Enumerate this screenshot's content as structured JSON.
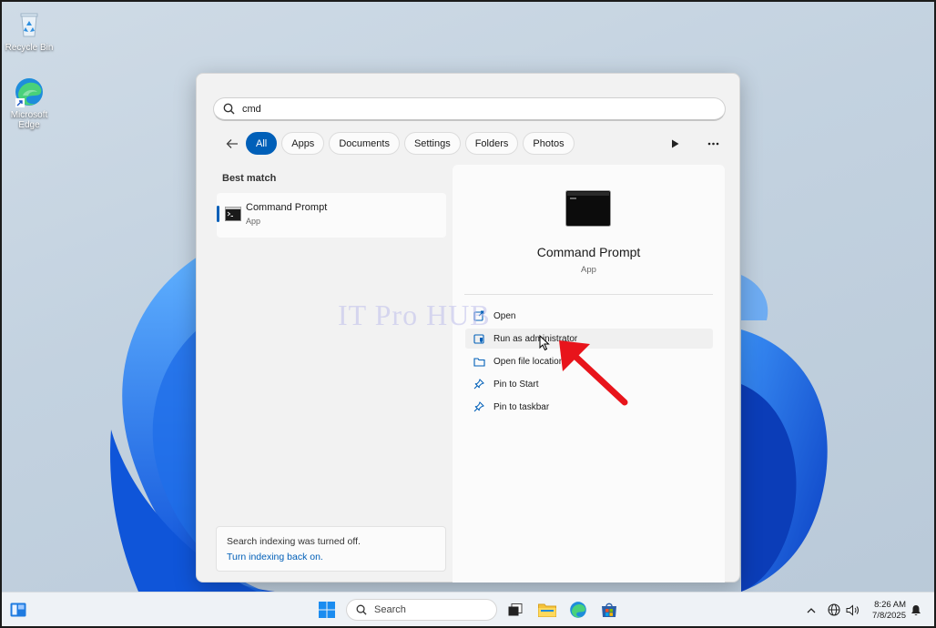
{
  "desktop": {
    "icons": [
      {
        "label": "Recycle Bin"
      },
      {
        "label": "Microsoft Edge"
      }
    ]
  },
  "search": {
    "query": "cmd",
    "filters": [
      "All",
      "Apps",
      "Documents",
      "Settings",
      "Folders",
      "Photos"
    ],
    "active_filter": "All"
  },
  "results": {
    "section_label": "Best match",
    "best_match": {
      "title": "Command Prompt",
      "type": "App"
    }
  },
  "indexing": {
    "message": "Search indexing was turned off.",
    "link": "Turn indexing back on."
  },
  "detail": {
    "title": "Command Prompt",
    "type": "App",
    "actions": [
      {
        "label": "Open",
        "icon": "open-external-icon"
      },
      {
        "label": "Run as administrator",
        "icon": "shield-icon"
      },
      {
        "label": "Open file location",
        "icon": "folder-icon"
      },
      {
        "label": "Pin to Start",
        "icon": "pin-icon"
      },
      {
        "label": "Pin to taskbar",
        "icon": "pin-icon"
      }
    ]
  },
  "watermark": "IT Pro HUB",
  "taskbar": {
    "search_placeholder": "Search",
    "time": "8:26 AM",
    "date": "7/8/2025"
  },
  "colors": {
    "accent": "#005fb8",
    "annotation_arrow": "#e8141b"
  }
}
